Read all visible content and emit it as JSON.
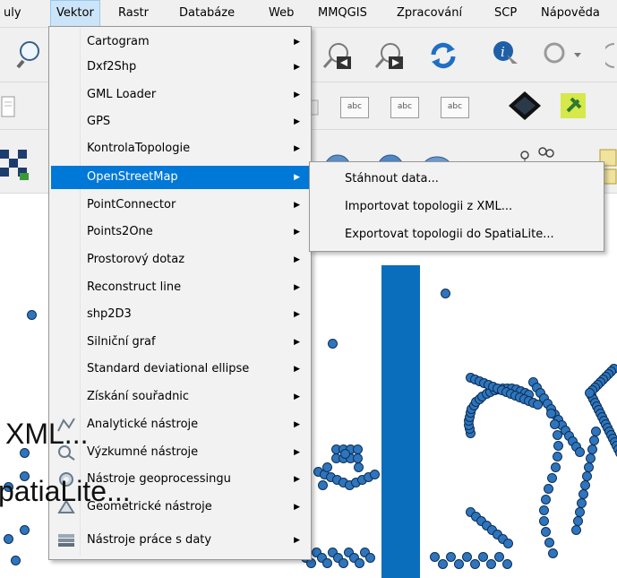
{
  "menubar": {
    "items": [
      "uly",
      "Vektor",
      "Rastr",
      "Databáze",
      "Web",
      "MMQGIS",
      "Zpracování",
      "SCP",
      "Nápověda"
    ]
  },
  "toolbar": {
    "labels": [
      "abc",
      "abc",
      "abc"
    ]
  },
  "vector_menu": {
    "items": [
      {
        "label": "Cartogram",
        "has_submenu": true
      },
      {
        "label": "Dxf2Shp",
        "has_submenu": true
      },
      {
        "label": "GML Loader",
        "has_submenu": true
      },
      {
        "label": "GPS",
        "has_submenu": true
      },
      {
        "label": "KontrolaTopologie",
        "has_submenu": true
      },
      {
        "label": "OpenStreetMap",
        "has_submenu": true,
        "highlighted": true
      },
      {
        "label": "PointConnector",
        "has_submenu": true
      },
      {
        "label": "Points2One",
        "has_submenu": true
      },
      {
        "label": "Prostorový dotaz",
        "has_submenu": true
      },
      {
        "label": "Reconstruct line",
        "has_submenu": true
      },
      {
        "label": "shp2D3",
        "has_submenu": true
      },
      {
        "label": "Silniční graf",
        "has_submenu": true
      },
      {
        "label": "Standard deviational ellipse",
        "has_submenu": true
      },
      {
        "label": "Získání souřadnic",
        "has_submenu": true
      },
      {
        "label": "Analytické nástroje",
        "has_submenu": true,
        "icon": "analysis-icon"
      },
      {
        "label": "Výzkumné nástroje",
        "has_submenu": true,
        "icon": "research-icon"
      },
      {
        "label": "Nástroje geoprocessingu",
        "has_submenu": true,
        "icon": "geoprocessing-icon"
      },
      {
        "label": "Geometrické nástroje",
        "has_submenu": true,
        "icon": "geometry-icon"
      },
      {
        "label": "Nástroje práce s daty",
        "has_submenu": true,
        "icon": "data-management-icon"
      }
    ],
    "arrow": "▶"
  },
  "osm_submenu": {
    "items": [
      "Stáhnout data...",
      "Importovat topologii z XML...",
      "Exportovat topologii do SpatiaLite..."
    ]
  },
  "overlay": {
    "line1": "XML...",
    "line2": "patiaLite..."
  },
  "colors": {
    "highlight": "#0078d7",
    "point_fill": "#2e75bd",
    "bar": "#0a6ebd"
  }
}
